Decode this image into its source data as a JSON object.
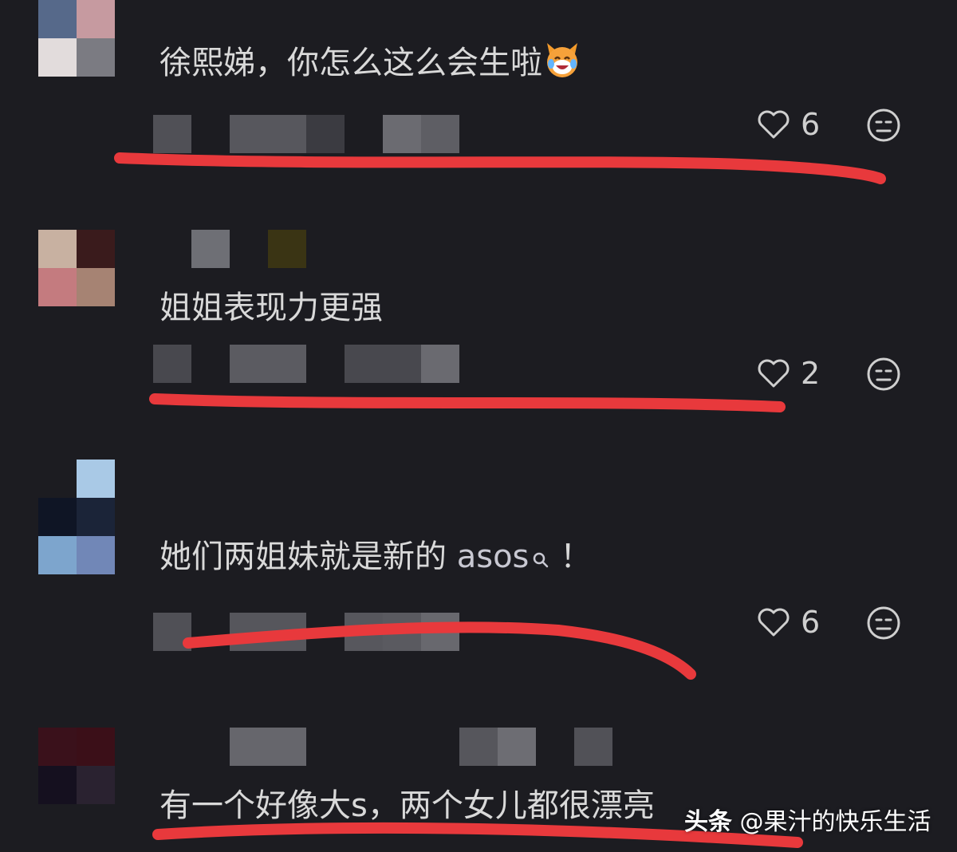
{
  "comments": [
    {
      "text": "徐熙娣，你怎么这么会生啦",
      "emoji": "laughing-cat-emoji",
      "likes": "6"
    },
    {
      "text": "姐姐表现力更强",
      "likes": "2"
    },
    {
      "text_cn": "她们两姐妹就是新的",
      "text_en": "asos",
      "search_icon": "search-icon",
      "text_tail": "！",
      "likes": "6"
    },
    {
      "text": "有一个好像大s，两个女儿都很漂亮"
    }
  ],
  "watermark": {
    "brand": "头条",
    "handle": "@果汁的快乐生活"
  },
  "colors": {
    "background": "#1c1c21",
    "underline": "#e8393c"
  }
}
